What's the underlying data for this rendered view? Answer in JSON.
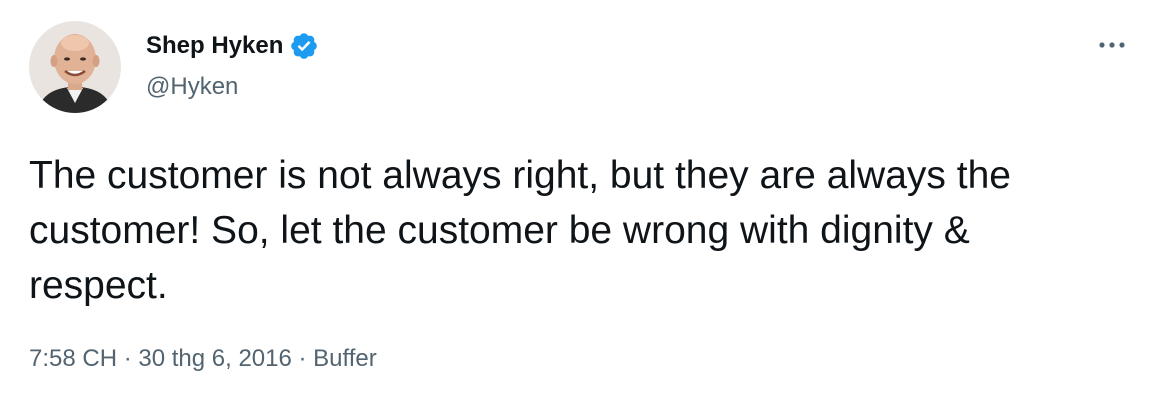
{
  "author": {
    "display_name": "Shep Hyken",
    "handle": "@Hyken",
    "verified": true,
    "verified_color": "#1d9bf0"
  },
  "tweet": {
    "text": "The customer is not always right, but they are always the customer! So, let the customer be wrong with dignity & respect."
  },
  "meta": {
    "time": "7:58 CH",
    "separator": " · ",
    "date": "30 thg 6, 2016",
    "source": "Buffer"
  },
  "icons": {
    "avatar": "profile-photo",
    "verified": "verified-badge-icon",
    "more": "more-options-icon"
  },
  "colors": {
    "text_primary": "#0f1419",
    "text_secondary": "#536471",
    "background": "#ffffff"
  }
}
